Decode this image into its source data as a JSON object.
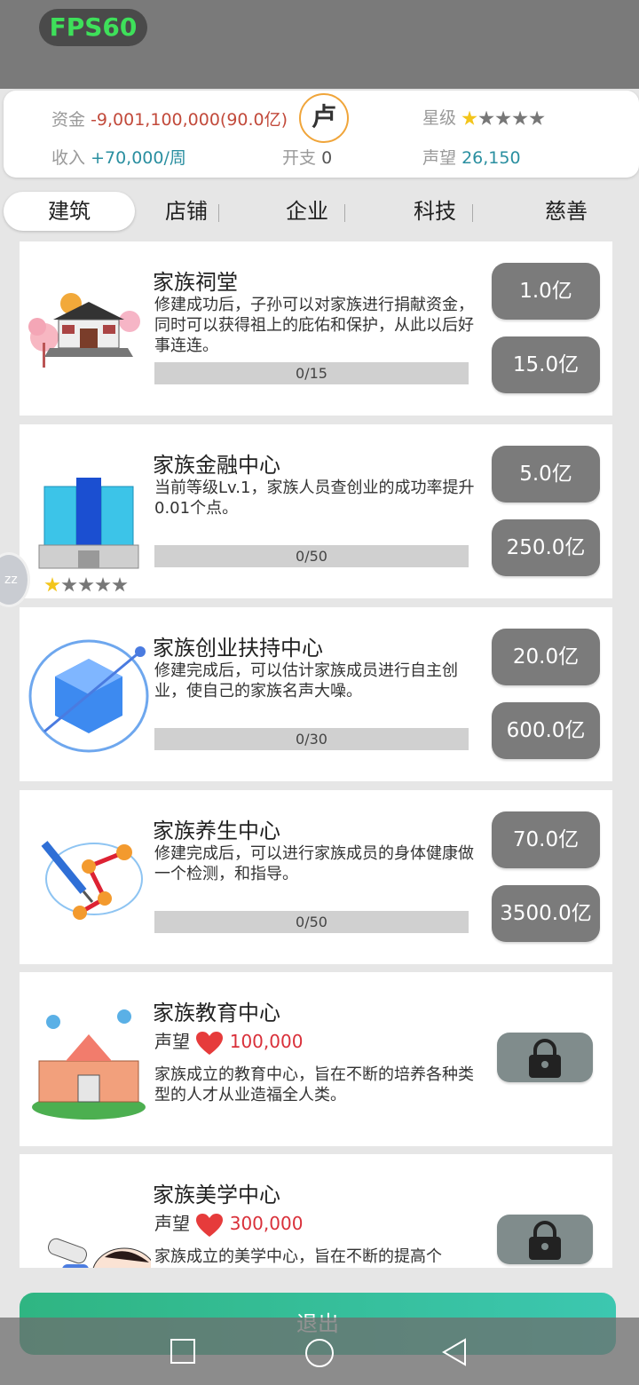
{
  "fps": {
    "label": "FPS60"
  },
  "header": {
    "funds_label": "资金",
    "funds_value": "-9,001,100,000(90.0亿)",
    "avatar_char": "卢",
    "star_label": "星级",
    "star_rating": 1,
    "star_max": 5,
    "income_label": "收入",
    "income_value": "+70,000/周",
    "expense_label": "开支",
    "expense_value": "0",
    "fame_label": "声望",
    "fame_value": "26,150"
  },
  "tabs": [
    {
      "label": "建筑",
      "active": true
    },
    {
      "label": "店铺"
    },
    {
      "label": "企业"
    },
    {
      "label": "科技"
    },
    {
      "label": "慈善"
    }
  ],
  "cards": [
    {
      "icon": "ancestral-hall-icon",
      "title": "家族祠堂",
      "desc": "修建成功后，子孙可以对家族进行捐献资金，同时可以获得祖上的庇佑和保护，从此以后好事连连。",
      "progress": "0/15",
      "btn1": "1.0亿",
      "btn2": "15.0亿"
    },
    {
      "icon": "finance-building-icon",
      "title": "家族金融中心",
      "desc": "当前等级Lv.1，家族人员查创业的成功率提升0.01个点。",
      "progress": "0/50",
      "btn1": "5.0亿",
      "btn2": "250.0亿",
      "stars": 1
    },
    {
      "icon": "cube-orbit-icon",
      "title": "家族创业扶持中心",
      "desc": "修建完成后，可以估计家族成员进行自主创业，使自己的家族名声大噪。",
      "progress": "0/30",
      "btn1": "20.0亿",
      "btn2": "600.0亿"
    },
    {
      "icon": "syringe-molecule-icon",
      "title": "家族养生中心",
      "desc": "修建完成后，可以进行家族成员的身体健康做一个检测，和指导。",
      "progress": "0/50",
      "btn1": "70.0亿",
      "btn2": "3500.0亿"
    }
  ],
  "locked_cards": [
    {
      "icon": "school-building-icon",
      "title": "家族教育中心",
      "req_label": "声望",
      "req_value": "100,000",
      "desc": "家族成立的教育中心，旨在不断的培养各种类型的人才从业造福全人类。"
    },
    {
      "icon": "beauty-treatment-icon",
      "title": "家族美学中心",
      "req_label": "声望",
      "req_value": "300,000",
      "desc": "家族成立的美学中心，旨在不断的提高个"
    }
  ],
  "float_ball": {
    "label": "zz"
  },
  "exit_button": {
    "label": "退出"
  },
  "nav": {
    "icons": [
      "square-icon",
      "circle-icon",
      "triangle-back-icon"
    ]
  }
}
